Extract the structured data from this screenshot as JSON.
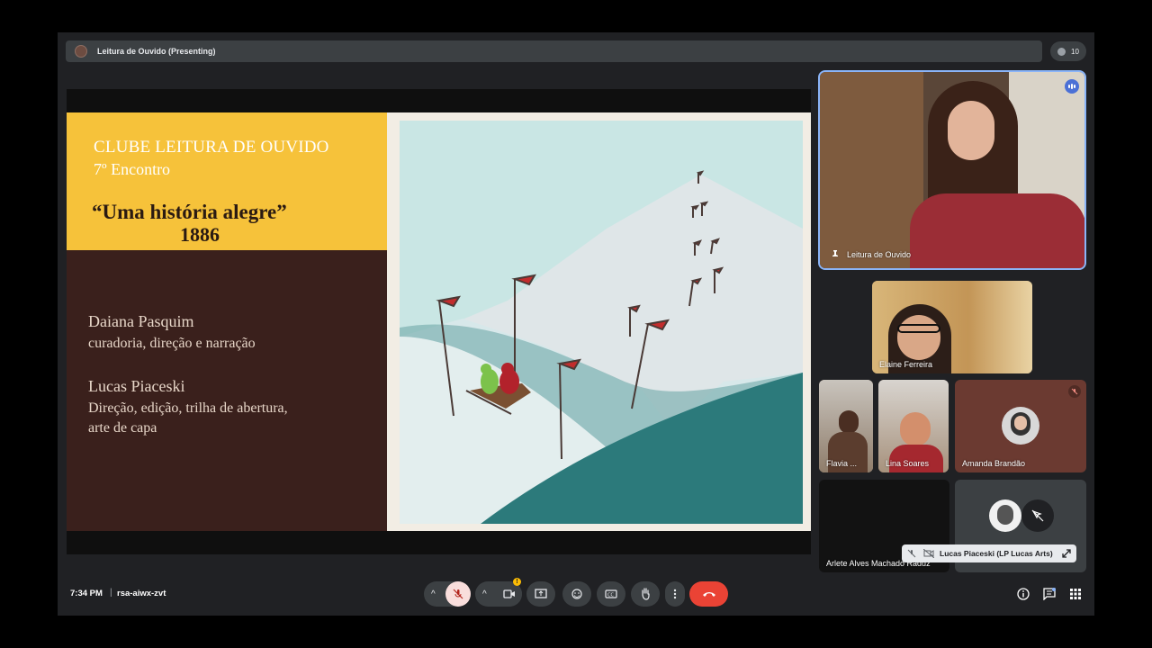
{
  "topbar": {
    "presenting_title": "Leitura de Ouvido (Presenting)",
    "participant_count": "10"
  },
  "slide": {
    "club_title": "CLUBE LEITURA DE OUVIDO",
    "meeting": "7º Encontro",
    "story": "“Uma história alegre”",
    "year": "1886",
    "credits": [
      {
        "name": "Daiana Pasquim",
        "role_lines": [
          "curadoria, direção e narração"
        ]
      },
      {
        "name": "Lucas Piaceski",
        "role_lines": [
          "Direção, edição, trilha de abertura,",
          "arte de capa"
        ]
      }
    ]
  },
  "participants": {
    "host": "Leitura de Ouvido",
    "elaine": "Elaine Ferreira",
    "flavia": "Flavia ...",
    "lina": "Lina Soares",
    "amanda": "Amanda Brandão",
    "arlete": "Arlete Alves Machado Raduz",
    "lucas": "Lucas Piaceski (LP Lucas Arts)"
  },
  "bottombar": {
    "time": "7:34 PM",
    "separator": "|",
    "meeting_code": "rsa-aiwx-zvt"
  },
  "icons": {
    "controls": [
      "chevron-up-icon",
      "mic-off-icon",
      "chevron-up-icon",
      "camera-icon",
      "present-icon",
      "emoji-icon",
      "captions-icon",
      "raise-hand-icon",
      "more-icon",
      "hang-up-icon"
    ],
    "right": [
      "info-icon",
      "chat-icon",
      "activities-icon"
    ]
  },
  "colors": {
    "leave": "#ea4335",
    "mic_off_bg": "#f9dedc",
    "slide_yellow": "#f6c23a",
    "slide_brown": "#3a201c",
    "active_border": "#8ab4f8"
  }
}
